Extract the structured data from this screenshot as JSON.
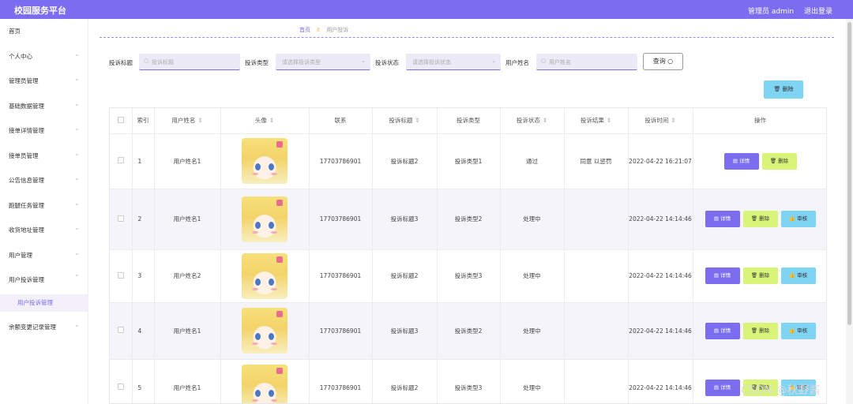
{
  "app": {
    "title": "校园服务平台",
    "admin_label": "管理员 admin",
    "logout": "退出登录"
  },
  "sidebar": {
    "items": [
      {
        "label": "首页"
      },
      {
        "label": "个人中心"
      },
      {
        "label": "管理员管理"
      },
      {
        "label": "基础数据管理"
      },
      {
        "label": "接单详情管理"
      },
      {
        "label": "接单员管理"
      },
      {
        "label": "公告信息管理"
      },
      {
        "label": "跑腿任务管理"
      },
      {
        "label": "收货地址管理"
      },
      {
        "label": "用户管理"
      },
      {
        "label": "用户投诉管理"
      }
    ],
    "active_sub": "用户投诉管理",
    "last_item": "余额变更记录管理"
  },
  "breadcrumb": {
    "home": "首页",
    "current": "用户投诉"
  },
  "filters": {
    "title_label": "投诉标题",
    "title_placeholder": "投诉标题",
    "type_label": "投诉类型",
    "type_placeholder": "请选择投诉类型",
    "status_label": "投诉状态",
    "status_placeholder": "请选择投诉状态",
    "name_label": "用户姓名",
    "name_placeholder": "用户姓名",
    "query_button": "查询"
  },
  "toolbar": {
    "delete_label": "删除"
  },
  "table": {
    "headers": {
      "index": "索引",
      "name": "用户姓名",
      "avatar": "头像",
      "contact": "联系",
      "title": "投诉标题",
      "type": "投诉类型",
      "status": "投诉状态",
      "result": "投诉结果",
      "time": "投诉时间",
      "ops": "操作"
    },
    "buttons": {
      "detail": "详情",
      "delete": "删除",
      "review": "审核"
    },
    "rows": [
      {
        "index": "1",
        "name": "用户姓名1",
        "contact": "17703786901",
        "title": "投诉标题2",
        "type": "投诉类型1",
        "status": "通过",
        "result": "同意 以惩罚",
        "time": "2022-04-22 16:21:07"
      },
      {
        "index": "2",
        "name": "用户姓名1",
        "contact": "17703786901",
        "title": "投诉标题3",
        "type": "投诉类型2",
        "status": "处理中",
        "result": "",
        "time": "2022-04-22 14:14:46"
      },
      {
        "index": "3",
        "name": "用户姓名2",
        "contact": "17703786901",
        "title": "投诉标题2",
        "type": "投诉类型3",
        "status": "处理中",
        "result": "",
        "time": "2022-04-22 14:14:46"
      },
      {
        "index": "4",
        "name": "用户姓名1",
        "contact": "17703786901",
        "title": "投诉标题3",
        "type": "投诉类型2",
        "status": "处理中",
        "result": "",
        "time": "2022-04-22 14:14:46"
      },
      {
        "index": "5",
        "name": "用户姓名1",
        "contact": "17703786901",
        "title": "投诉标题2",
        "type": "投诉类型3",
        "status": "处理中",
        "result": "",
        "time": "2022-04-22 14:14:46"
      }
    ]
  },
  "watermark": "CSDN @秋野酱"
}
